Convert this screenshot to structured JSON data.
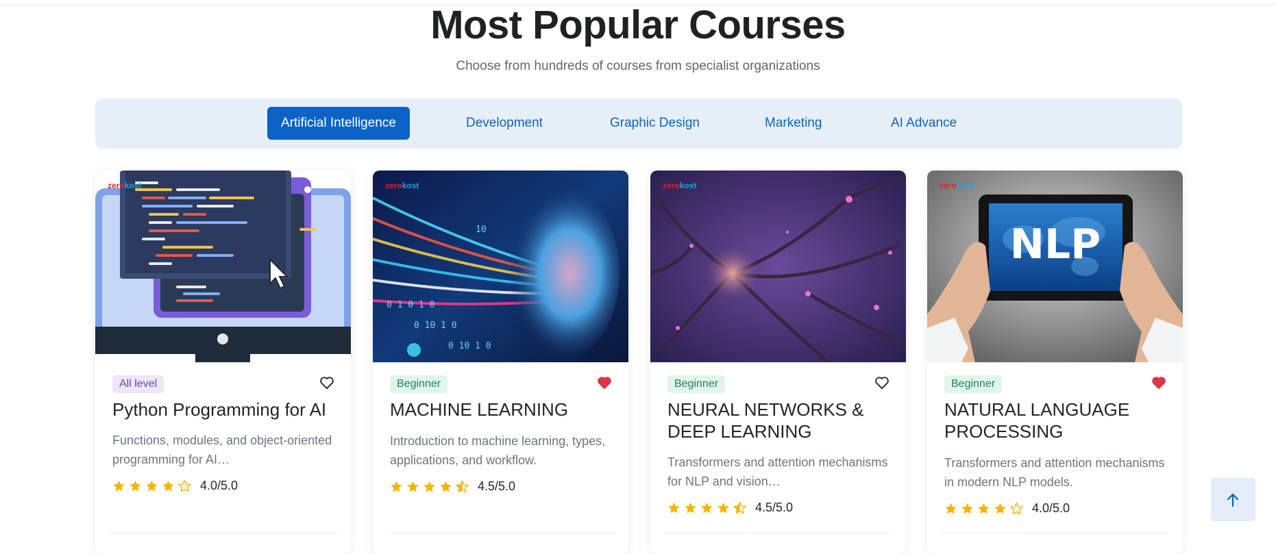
{
  "section": {
    "title": "Most Popular Courses",
    "subtitle": "Choose from hundreds of courses from specialist organizations"
  },
  "tabs": [
    {
      "label": "Artificial Intelligence",
      "active": true
    },
    {
      "label": "Development",
      "active": false
    },
    {
      "label": "Graphic Design",
      "active": false
    },
    {
      "label": "Marketing",
      "active": false
    },
    {
      "label": "AI Advance",
      "active": false
    }
  ],
  "brand": {
    "logo_part1": "zero",
    "logo_part2": "kost"
  },
  "courses": [
    {
      "level": "All level",
      "title": "Python Programming for AI",
      "description": "Functions, modules, and object-oriented programming for AI…",
      "rating": 4.0,
      "rating_text": "4.0/5.0",
      "favorited": false,
      "image": "code-editor-monitor-illustration"
    },
    {
      "level": "Beginner",
      "title": "MACHINE LEARNING",
      "description": "Introduction to machine learning, types, applications, and workflow.",
      "rating": 4.5,
      "rating_text": "4.5/5.0",
      "favorited": true,
      "image": "digital-head-binary-photo"
    },
    {
      "level": "Beginner",
      "title": "NEURAL NETWORKS & DEEP LEARNING",
      "description": "Transformers and attention mechanisms for NLP and vision…",
      "rating": 4.5,
      "rating_text": "4.5/5.0",
      "favorited": false,
      "image": "neuron-network-photo"
    },
    {
      "level": "Beginner",
      "title": "NATURAL LANGUAGE PROCESSING",
      "description": "Transformers and attention mechanisms in modern NLP models.",
      "rating": 4.0,
      "rating_text": "4.0/5.0",
      "favorited": true,
      "image": "hands-holding-tablet-nlp-photo",
      "image_text": "NLP"
    }
  ],
  "colors": {
    "primary": "#0b63c5",
    "star": "#f5b301",
    "heart": "#dc3545",
    "tabbar_bg": "#e6eff8"
  },
  "icons": {
    "scroll_top": "arrow-up-icon",
    "favorite": "heart-icon",
    "rating": "star-icon"
  }
}
